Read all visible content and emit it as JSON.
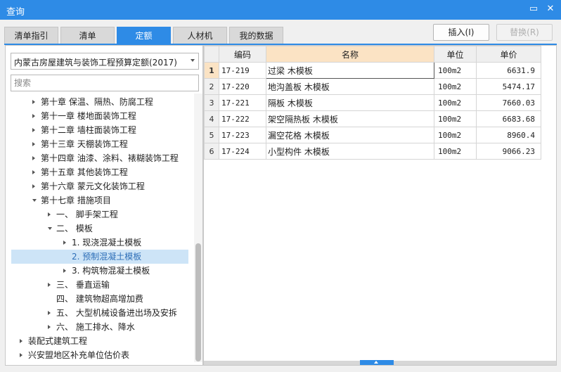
{
  "window": {
    "title": "查询",
    "minimize_glyph": "▭",
    "close_glyph": "✕"
  },
  "tabs": [
    {
      "label": "清单指引"
    },
    {
      "label": "清单"
    },
    {
      "label": "定额",
      "active": true
    },
    {
      "label": "人材机"
    },
    {
      "label": "我的数据"
    }
  ],
  "buttons": {
    "insert": "插入(I)",
    "replace": "替换(R)"
  },
  "left": {
    "quota_select": "内蒙古房屋建筑与装饰工程预算定额(2017)",
    "search_placeholder": "搜索",
    "tree": [
      {
        "label": "第十章 保温、隔热、防腐工程",
        "level": 1,
        "toggle": "right"
      },
      {
        "label": "第十一章 楼地面装饰工程",
        "level": 1,
        "toggle": "right"
      },
      {
        "label": "第十二章 墙柱面装饰工程",
        "level": 1,
        "toggle": "right"
      },
      {
        "label": "第十三章 天棚装饰工程",
        "level": 1,
        "toggle": "right"
      },
      {
        "label": "第十四章 油漆、涂料、裱糊装饰工程",
        "level": 1,
        "toggle": "right"
      },
      {
        "label": "第十五章 其他装饰工程",
        "level": 1,
        "toggle": "right"
      },
      {
        "label": "第十六章 蒙元文化装饰工程",
        "level": 1,
        "toggle": "right"
      },
      {
        "label": "第十七章 措施项目",
        "level": 1,
        "toggle": "down"
      },
      {
        "label": "一、 脚手架工程",
        "level": 2,
        "toggle": "right"
      },
      {
        "label": "二、 模板",
        "level": 2,
        "toggle": "down"
      },
      {
        "label": "1. 现浇混凝土模板",
        "level": 3,
        "toggle": "right"
      },
      {
        "label": "2. 预制混凝土模板",
        "level": 3,
        "toggle": "none",
        "selected": true
      },
      {
        "label": "3. 构筑物混凝土模板",
        "level": 3,
        "toggle": "right"
      },
      {
        "label": "三、 垂直运输",
        "level": 2,
        "toggle": "right"
      },
      {
        "label": "四、 建筑物超高增加费",
        "level": 2,
        "toggle": "none"
      },
      {
        "label": "五、 大型机械设备进出场及安拆",
        "level": 2,
        "toggle": "right"
      },
      {
        "label": "六、 施工排水、降水",
        "level": 2,
        "toggle": "right"
      },
      {
        "label": "装配式建筑工程",
        "level": 0,
        "toggle": "right"
      },
      {
        "label": "兴安盟地区补充单位估价表",
        "level": 0,
        "toggle": "right"
      }
    ]
  },
  "table": {
    "columns": {
      "code": "编码",
      "name": "名称",
      "unit": "单位",
      "price": "单价"
    },
    "current_row": 0,
    "rows": [
      {
        "no": "1",
        "code": "17-219",
        "name": "过梁 木模板",
        "unit": "100m2",
        "price": "6631.9"
      },
      {
        "no": "2",
        "code": "17-220",
        "name": "地沟盖板 木模板",
        "unit": "100m2",
        "price": "5474.17"
      },
      {
        "no": "3",
        "code": "17-221",
        "name": "隔板 木模板",
        "unit": "100m2",
        "price": "7660.03"
      },
      {
        "no": "4",
        "code": "17-222",
        "name": "架空隔热板 木模板",
        "unit": "100m2",
        "price": "6683.68"
      },
      {
        "no": "5",
        "code": "17-223",
        "name": "漏空花格 木模板",
        "unit": "100m2",
        "price": "8960.4"
      },
      {
        "no": "6",
        "code": "17-224",
        "name": "小型构件 木模板",
        "unit": "100m2",
        "price": "9066.23"
      }
    ]
  },
  "colors": {
    "accent": "#2e8be6",
    "selected_row_bg": "#cde4f7",
    "header_highlight": "#fbe3c4"
  }
}
